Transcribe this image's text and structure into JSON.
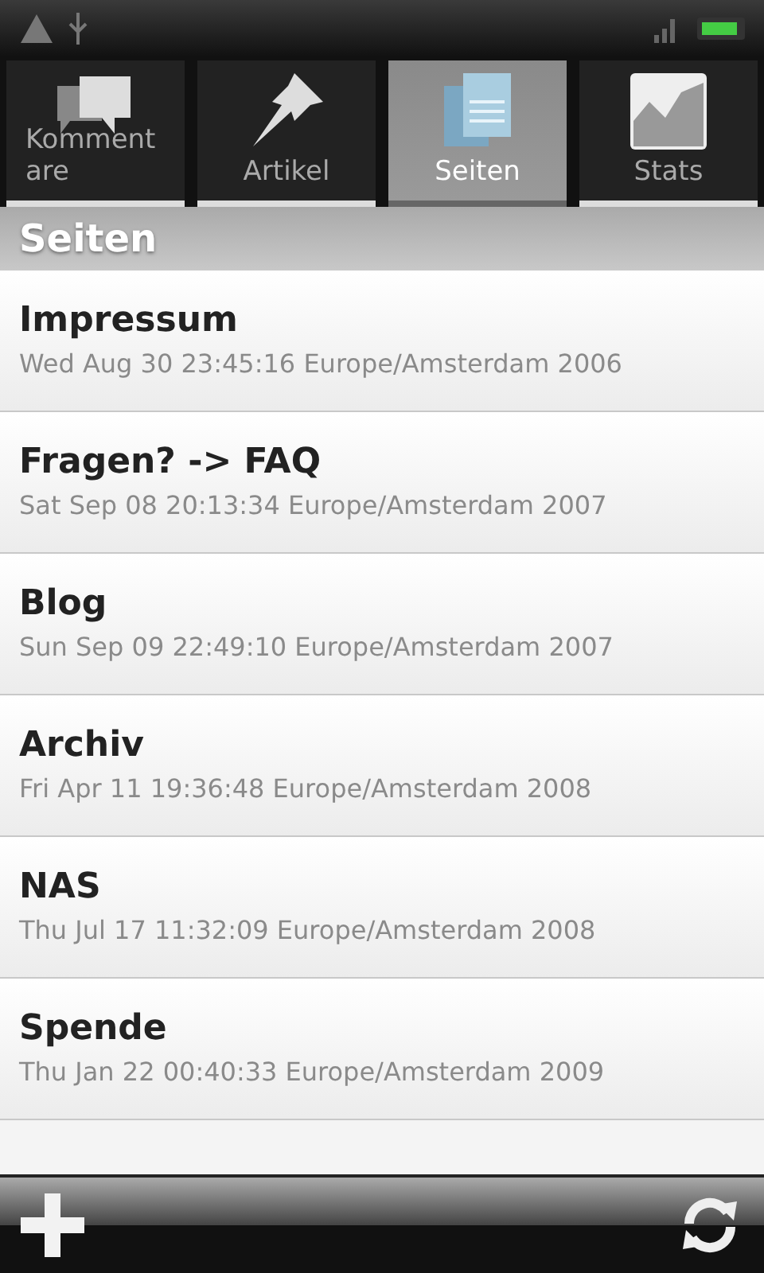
{
  "tabs": [
    {
      "label": "Kommentare",
      "kind": "comments",
      "selected": false
    },
    {
      "label": "Artikel",
      "kind": "pin",
      "selected": false
    },
    {
      "label": "Seiten",
      "kind": "pages",
      "selected": true
    },
    {
      "label": "Stats",
      "kind": "chart",
      "selected": false
    }
  ],
  "section_title": "Seiten",
  "pages": [
    {
      "title": "Impressum",
      "date": "Wed Aug 30 23:45:16 Europe/Amsterdam 2006"
    },
    {
      "title": "Fragen? -> FAQ",
      "date": "Sat Sep 08 20:13:34 Europe/Amsterdam 2007"
    },
    {
      "title": "Blog",
      "date": "Sun Sep 09 22:49:10 Europe/Amsterdam 2007"
    },
    {
      "title": "Archiv",
      "date": "Fri Apr 11 19:36:48 Europe/Amsterdam 2008"
    },
    {
      "title": "NAS",
      "date": "Thu Jul 17 11:32:09 Europe/Amsterdam 2008"
    },
    {
      "title": "Spende",
      "date": "Thu Jan 22 00:40:33 Europe/Amsterdam 2009"
    }
  ]
}
